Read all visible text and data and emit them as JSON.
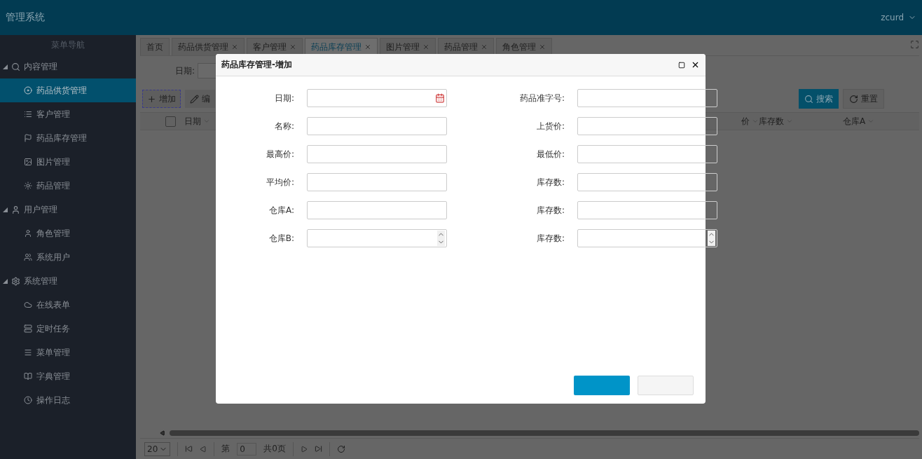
{
  "header": {
    "title": "管理系统",
    "user": "zcurd"
  },
  "sidebar": {
    "title": "菜单导航",
    "groups": [
      {
        "label": "内容管理",
        "expanded": true,
        "children": [
          {
            "label": "药品供货管理",
            "selected": true
          },
          {
            "label": "客户管理",
            "selected": false
          },
          {
            "label": "药品库存管理",
            "selected": false
          },
          {
            "label": "图片管理",
            "selected": false
          },
          {
            "label": "药品管理",
            "selected": false
          }
        ]
      },
      {
        "label": "用户管理",
        "expanded": true,
        "children": [
          {
            "label": "角色管理",
            "selected": false
          },
          {
            "label": "系统用户",
            "selected": false
          }
        ]
      },
      {
        "label": "系统管理",
        "expanded": true,
        "children": [
          {
            "label": "在线表单",
            "selected": false
          },
          {
            "label": "定时任务",
            "selected": false
          },
          {
            "label": "菜单管理",
            "selected": false
          },
          {
            "label": "字典管理",
            "selected": false
          },
          {
            "label": "操作日志",
            "selected": false
          }
        ]
      }
    ]
  },
  "tabs": [
    {
      "label": "首页",
      "closable": false,
      "selected": false
    },
    {
      "label": "药品供货管理",
      "closable": true,
      "selected": false
    },
    {
      "label": "客户管理",
      "closable": true,
      "selected": false
    },
    {
      "label": "药品库存管理",
      "closable": true,
      "selected": true
    },
    {
      "label": "图片管理",
      "closable": true,
      "selected": false
    },
    {
      "label": "药品管理",
      "closable": true,
      "selected": false
    },
    {
      "label": "角色管理",
      "closable": true,
      "selected": false
    }
  ],
  "filter": {
    "label": "日期:",
    "search": "搜索",
    "reset": "重置"
  },
  "toolbar": [
    {
      "label": "增加"
    },
    {
      "label": "编"
    }
  ],
  "table": {
    "select_all": {
      "checked": false
    },
    "columns": [
      {
        "label": "日期"
      },
      {
        "label": "价"
      },
      {
        "label": "库存数"
      },
      {
        "label": "仓库A"
      }
    ]
  },
  "pager": {
    "page_size": "20",
    "page_label": "第",
    "page": "0",
    "total": "共0页"
  },
  "dialog": {
    "title": "药品库存管理-增加",
    "fields": [
      {
        "label": "日期:",
        "kind": "date"
      },
      {
        "label": "药品准字号:",
        "kind": "text"
      },
      {
        "label": "名称:",
        "kind": "text"
      },
      {
        "label": "上货价:",
        "kind": "text"
      },
      {
        "label": "最高价:",
        "kind": "text"
      },
      {
        "label": "最低价:",
        "kind": "text"
      },
      {
        "label": "平均价:",
        "kind": "text"
      },
      {
        "label": "库存数:",
        "kind": "text"
      },
      {
        "label": "仓库A:",
        "kind": "text"
      },
      {
        "label": "库存数:",
        "kind": "text"
      },
      {
        "label": "仓库B:",
        "kind": "number"
      },
      {
        "label": "库存数:",
        "kind": "number"
      }
    ]
  }
}
